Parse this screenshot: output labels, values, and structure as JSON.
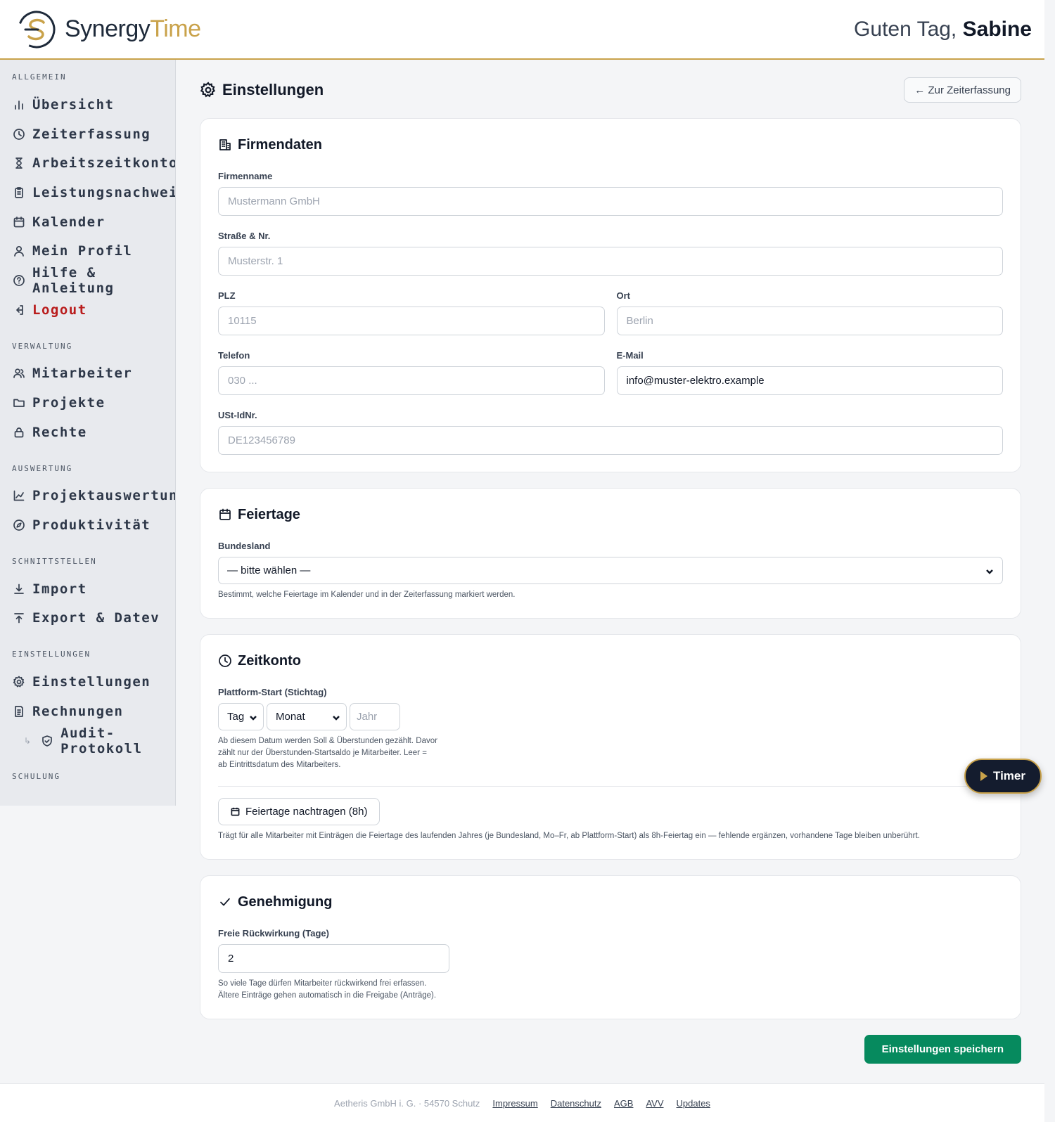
{
  "header": {
    "brand_part1": "Synergy",
    "brand_part2": "Time",
    "greeting": "Guten Tag,",
    "user_name": "Sabine"
  },
  "sidebar": {
    "sections": [
      {
        "title": "ALLGEMEIN",
        "items": [
          {
            "label": "Übersicht",
            "icon": "bar-chart-icon"
          },
          {
            "label": "Zeiterfassung",
            "icon": "clock-icon"
          },
          {
            "label": "Arbeitszeitkonto",
            "icon": "hourglass-icon"
          },
          {
            "label": "Leistungsnachweis",
            "icon": "clipboard-icon"
          },
          {
            "label": "Kalender",
            "icon": "calendar-icon"
          },
          {
            "label": "Mein Profil",
            "icon": "user-icon"
          },
          {
            "label": "Hilfe & Anleitung",
            "icon": "help-circle-icon"
          },
          {
            "label": "Logout",
            "icon": "logout-icon"
          }
        ]
      },
      {
        "title": "VERWALTUNG",
        "items": [
          {
            "label": "Mitarbeiter",
            "icon": "users-icon"
          },
          {
            "label": "Projekte",
            "icon": "folder-icon"
          },
          {
            "label": "Rechte",
            "icon": "lock-icon"
          }
        ]
      },
      {
        "title": "AUSWERTUNG",
        "items": [
          {
            "label": "Projektauswertung",
            "icon": "line-chart-icon"
          },
          {
            "label": "Produktivität",
            "icon": "compass-icon"
          }
        ]
      },
      {
        "title": "SCHNITTSTELLEN",
        "items": [
          {
            "label": "Import",
            "icon": "download-icon"
          },
          {
            "label": "Export & Datev",
            "icon": "upload-icon"
          }
        ]
      },
      {
        "title": "EINSTELLUNGEN",
        "items": [
          {
            "label": "Einstellungen",
            "icon": "gear-icon"
          },
          {
            "label": "Rechnungen",
            "icon": "document-icon"
          },
          {
            "label": "Audit-Protokoll",
            "icon": "shield-check-icon"
          }
        ]
      },
      {
        "title": "SCHULUNG",
        "items": []
      }
    ]
  },
  "page": {
    "title": "Einstellungen",
    "back_label": "← Zur Zeiterfassung",
    "save_label": "Einstellungen speichern"
  },
  "firmendaten": {
    "title": "Firmendaten",
    "firmenname_label": "Firmenname",
    "firmenname_placeholder": "Mustermann GmbH",
    "strasse_label": "Straße & Nr.",
    "strasse_placeholder": "Musterstr. 1",
    "plz_label": "PLZ",
    "plz_placeholder": "10115",
    "ort_label": "Ort",
    "ort_placeholder": "Berlin",
    "telefon_label": "Telefon",
    "telefon_placeholder": "030 ...",
    "email_label": "E-Mail",
    "email_value": "info@muster-elektro.example",
    "ust_label": "USt-IdNr.",
    "ust_placeholder": "DE123456789"
  },
  "feiertage": {
    "title": "Feiertage",
    "bundesland_label": "Bundesland",
    "bundesland_value": "— bitte wählen —",
    "hint": "Bestimmt, welche Feiertage im Kalender und in der Zeiterfassung markiert werden."
  },
  "zeitkonto": {
    "title": "Zeitkonto",
    "start_label": "Plattform-Start (Stichtag)",
    "tag_value": "Tag",
    "monat_value": "Monat",
    "jahr_placeholder": "Jahr",
    "hint_line1": "Ab diesem Datum werden Soll & Überstunden gezählt. Davor",
    "hint_line2": "zählt nur der Überstunden-Startsaldo je Mitarbeiter. Leer =",
    "hint_line3": "ab Eintrittsdatum des Mitarbeiters.",
    "nachtragen_label": "Feiertage nachtragen (8h)",
    "nachtragen_hint": "Trägt für alle Mitarbeiter mit Einträgen die Feiertage des laufenden Jahres (je Bundesland, Mo–Fr, ab Plattform-Start) als 8h-Feiertag ein — fehlende ergänzen, vorhandene Tage bleiben unberührt."
  },
  "genehmigung": {
    "title": "Genehmigung",
    "rueck_label": "Freie Rückwirkung (Tage)",
    "rueck_value": "2",
    "hint_line1": "So viele Tage dürfen Mitarbeiter rückwirkend frei erfassen.",
    "hint_line2": "Ältere Einträge gehen automatisch in die Freigabe (Anträge)."
  },
  "timer": {
    "label": "Timer"
  },
  "footer": {
    "company": "Aetheris GmbH i. G. · 54570 Schutz",
    "links": [
      "Impressum",
      "Datenschutz",
      "AGB",
      "AVV",
      "Updates"
    ]
  },
  "colors": {
    "brand_gold": "#c9a24a",
    "brand_navy": "#1e2a3a",
    "save_green": "#068a5e",
    "logout_red": "#b91c1c"
  }
}
